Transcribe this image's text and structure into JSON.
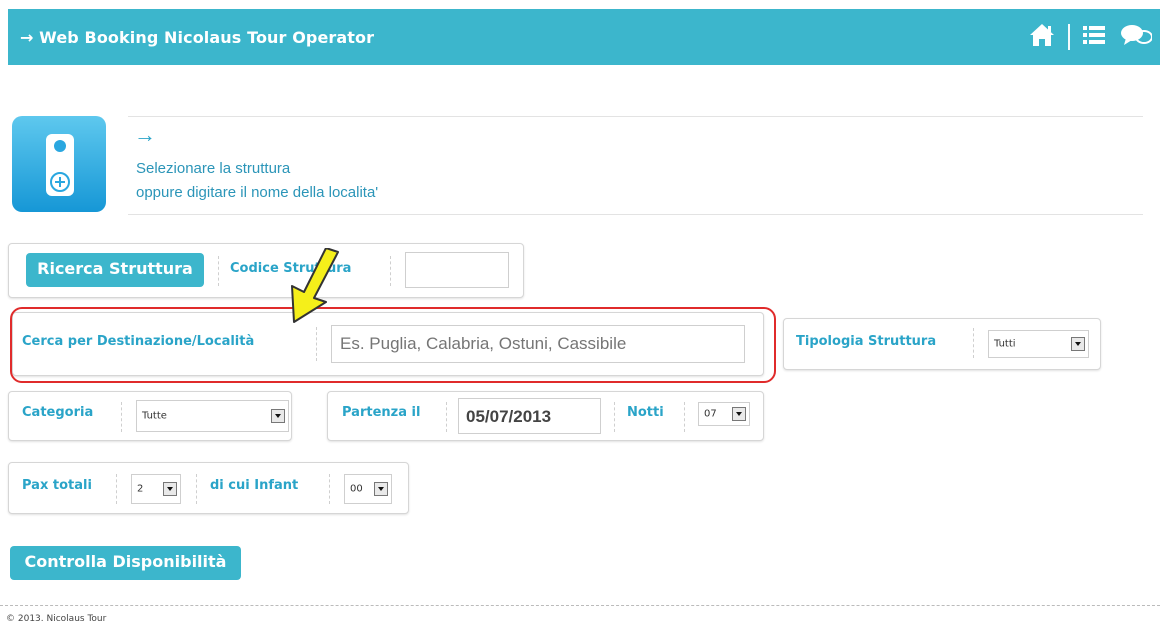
{
  "header": {
    "title": "→ Web Booking Nicolaus Tour Operator",
    "background": "#3cb6cc",
    "icons": [
      "home-icon",
      "list-icon",
      "chat-icon"
    ]
  },
  "intro": {
    "arrow": "→",
    "line1": "Selezionare la struttura",
    "line2": "oppure digitare il nome della localita'"
  },
  "search_struttura": {
    "button_label": "Ricerca Struttura",
    "codice_label": "Codice Struttura",
    "codice_value": ""
  },
  "destinazione": {
    "label": "Cerca per Destinazione/Località",
    "placeholder": "Es. Puglia, Calabria, Ostuni, Cassibile"
  },
  "tipologia": {
    "label": "Tipologia Struttura",
    "value": "Tutti"
  },
  "categoria": {
    "label": "Categoria",
    "value": "Tutte"
  },
  "partenza": {
    "label": "Partenza il",
    "value": "05/07/2013"
  },
  "notti": {
    "label": "Notti",
    "value": "07"
  },
  "pax": {
    "label": "Pax totali",
    "value": "2"
  },
  "infant": {
    "label": "di cui Infant",
    "value": "00"
  },
  "actions": {
    "check_label": "Controlla Disponibilità"
  },
  "footer": {
    "text": "© 2013. Nicolaus Tour"
  },
  "colors": {
    "accent": "#3cb6cc",
    "label_text": "#2aa4c8",
    "highlight_frame": "#e02b2b",
    "pointer_arrow": "#f5ef1a"
  }
}
